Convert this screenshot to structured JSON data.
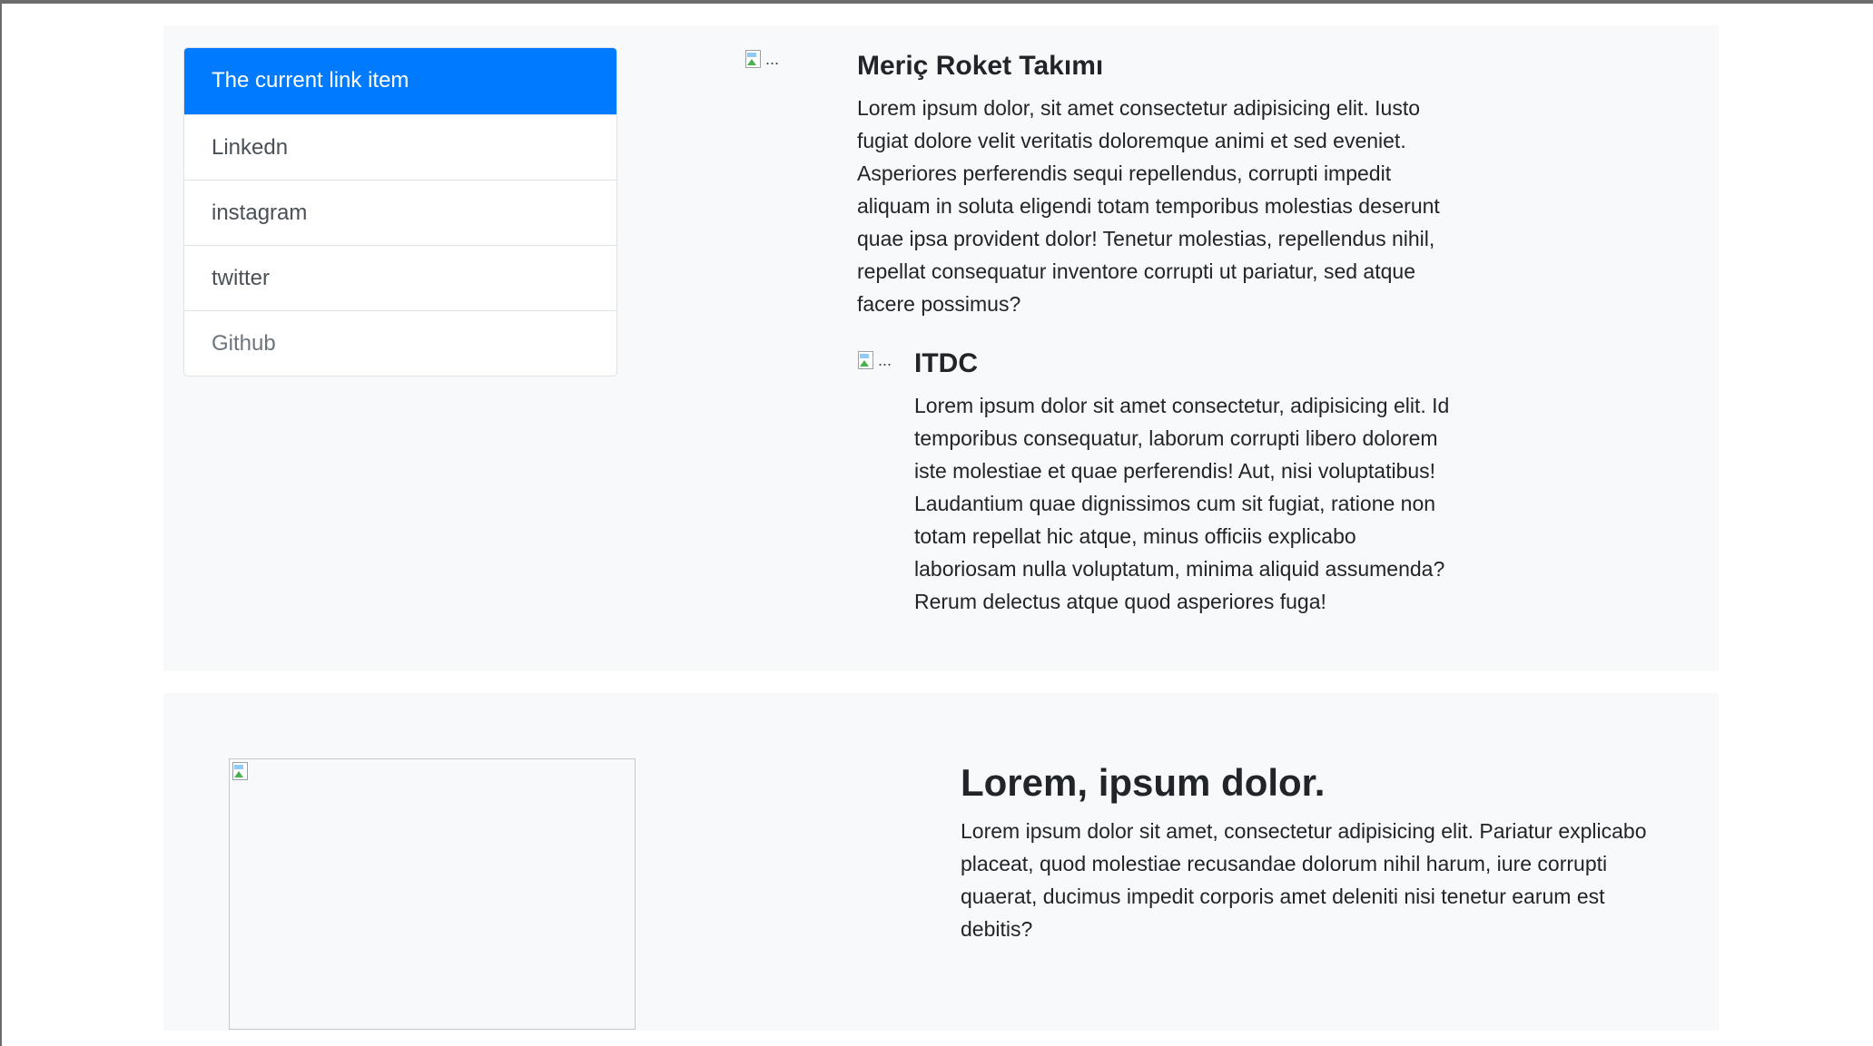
{
  "sidebar": {
    "items": [
      {
        "label": "The current link item",
        "state": "active"
      },
      {
        "label": "Linkedn",
        "state": "normal"
      },
      {
        "label": "instagram",
        "state": "normal"
      },
      {
        "label": "twitter",
        "state": "normal"
      },
      {
        "label": "Github",
        "state": "disabled"
      }
    ]
  },
  "media": {
    "image_alt": "...",
    "title": "Meriç Roket Takımı",
    "text": "Lorem ipsum dolor, sit amet consectetur adipisicing elit. Iusto fugiat dolore velit veritatis doloremque animi et sed eveniet. Asperiores perferendis sequi repellendus, corrupti impedit aliquam in soluta eligendi totam temporibus molestias deserunt quae ipsa provident dolor! Tenetur molestias, repellendus nihil, repellat consequatur inventore corrupti ut pariatur, sed atque facere possimus?",
    "nested": {
      "image_alt": "...",
      "title": "ITDC",
      "text": "Lorem ipsum dolor sit amet consectetur, adipisicing elit. Id temporibus consequatur, laborum corrupti libero dolorem iste molestiae et quae perferendis! Aut, nisi voluptatibus! Laudantium quae dignissimos cum sit fugiat, ratione non totam repellat hic atque, minus officiis explicabo laboriosam nulla voluptatum, minima aliquid assumenda? Rerum delectus atque quod asperiores fuga!"
    }
  },
  "feature": {
    "title": "Lorem, ipsum dolor.",
    "text": "Lorem ipsum dolor sit amet, consectetur adipisicing elit. Pariatur explicabo placeat, quod molestiae recusandae dolorum nihil harum, iure corrupti quaerat, ducimus impedit corporis amet deleniti nisi tenetur earum est debitis?"
  },
  "colors": {
    "accent": "#007bff",
    "section_bg": "#f8f9fa",
    "text": "#212529"
  }
}
